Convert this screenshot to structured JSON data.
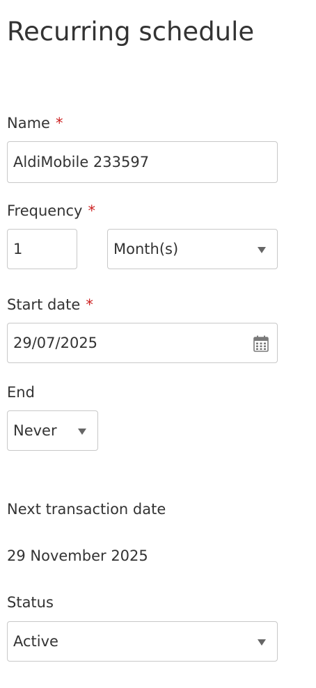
{
  "title": "Recurring schedule",
  "required_marker": "*",
  "name_field": {
    "label": "Name",
    "value": "AldiMobile 233597"
  },
  "frequency_field": {
    "label": "Frequency",
    "interval_value": "1",
    "unit_value": "Month(s)"
  },
  "start_date_field": {
    "label": "Start date",
    "value": "29/07/2025",
    "icon": "calendar-icon"
  },
  "end_field": {
    "label": "End",
    "value": "Never"
  },
  "next_transaction": {
    "label": "Next transaction date",
    "value": "29 November 2025"
  },
  "status_field": {
    "label": "Status",
    "value": "Active"
  },
  "colors": {
    "required": "#cc1f1f",
    "text": "#333333",
    "border": "#c8c8c8",
    "caret": "#666666"
  }
}
